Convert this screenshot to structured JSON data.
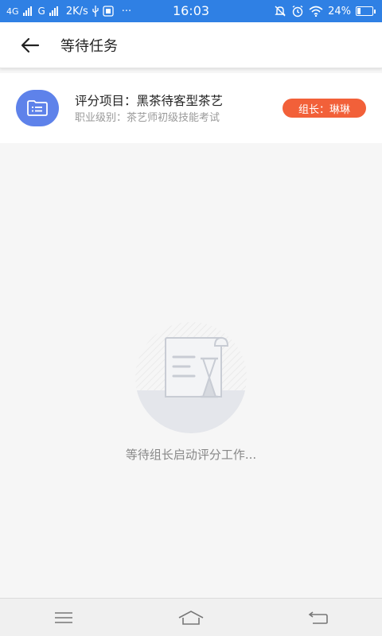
{
  "status_bar": {
    "network1": "4G",
    "network2": "G",
    "speed": "2K/s",
    "dots": "···",
    "time": "16:03",
    "battery": "24%",
    "battery_level": 0.24
  },
  "header": {
    "title": "等待任务"
  },
  "task": {
    "title": "评分项目：黑茶待客型茶艺",
    "subtitle": "职业级别：茶艺师初级技能考试",
    "leader": "组长：琳琳"
  },
  "empty_state": {
    "message": "等待组长启动评分工作..."
  },
  "colors": {
    "status_bar": "#2f80e4",
    "card_icon": "#5e82ea",
    "badge": "#f26039"
  },
  "icons": {
    "back": "back-arrow-icon",
    "card": "folder-list-icon",
    "illustration": "document-hourglass-icon",
    "nav_menu": "menu-icon",
    "nav_home": "home-icon",
    "nav_back": "return-icon"
  }
}
